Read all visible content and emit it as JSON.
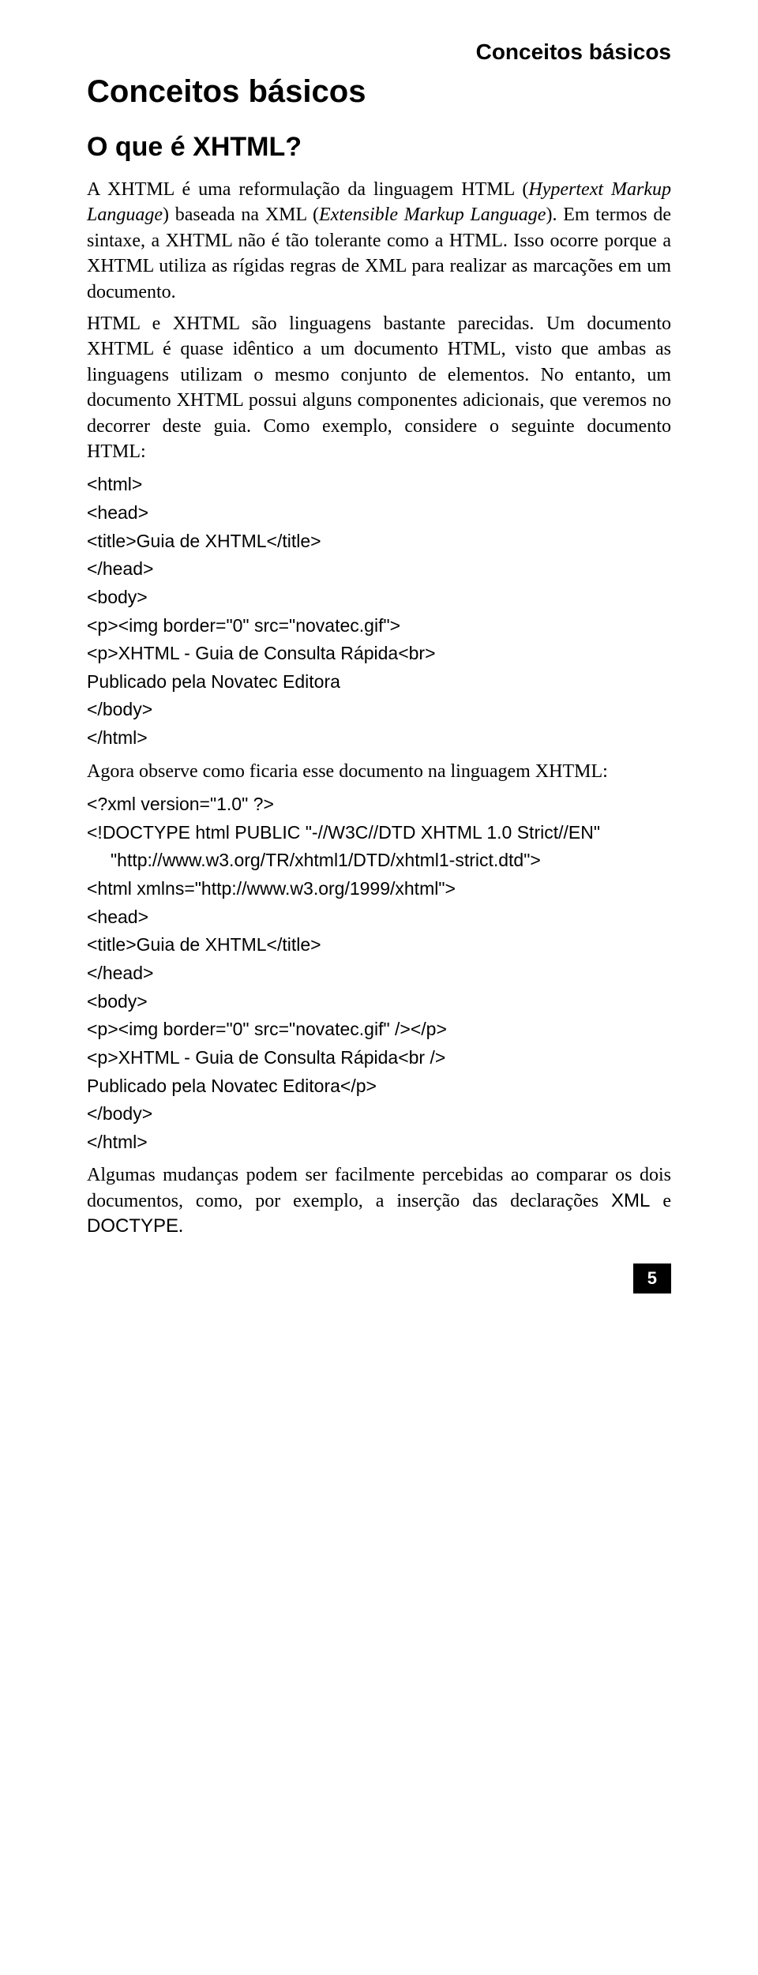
{
  "header": "Conceitos básicos",
  "chapter": "Conceitos básicos",
  "section": "O que é XHTML?",
  "p1_pre": "A XHTML é uma reformulação da linguagem HTML (",
  "p1_em1": "Hypertext Markup Language",
  "p1_mid": ") baseada na XML (",
  "p1_em2": "Extensible Markup Language",
  "p1_post": "). Em termos de sintaxe, a XHTML não é tão tolerante como a HTML. Isso ocorre porque a XHTML utiliza as rígidas regras de XML para realizar as marcações em um documento.",
  "p2": "HTML e XHTML são linguagens bastante parecidas. Um documento XHTML é quase idêntico a um documento HTML, visto que ambas as linguagens utilizam o mesmo conjunto de elementos. No entanto, um documento XHTML possui alguns componentes adicionais, que veremos no decorrer deste guia. Como exemplo, considere o seguinte documento HTML:",
  "code1": "<html>\n<head>\n<title>Guia de XHTML</title>\n</head>\n<body>\n<p><img border=\"0\" src=\"novatec.gif\">\n<p>XHTML - Guia de Consulta Rápida<br>\nPublicado pela Novatec Editora\n</body>\n</html>",
  "p3": "Agora observe como ficaria esse documento na linguagem XHTML:",
  "code2a": "<?xml version=\"1.0\" ?>\n<!DOCTYPE html PUBLIC \"-//W3C//DTD XHTML 1.0 Strict//EN\"",
  "code2b": "\"http://www.w3.org/TR/xhtml1/DTD/xhtml1-strict.dtd\">",
  "code2c": "<html xmlns=\"http://www.w3.org/1999/xhtml\">\n<head>\n<title>Guia de XHTML</title>\n</head>\n<body>\n<p><img border=\"0\" src=\"novatec.gif\" /></p>\n<p>XHTML - Guia de Consulta Rápida<br />\nPublicado pela Novatec Editora</p>\n</body>\n</html>",
  "p4_pre": "Algumas mudanças podem ser facilmente percebidas ao comparar os dois documentos, como, por exemplo, a inserção das declarações ",
  "p4_c1": "XML",
  "p4_mid": " e ",
  "p4_c2": "DOCTYPE",
  "p4_post": ".",
  "pagenum": "5"
}
